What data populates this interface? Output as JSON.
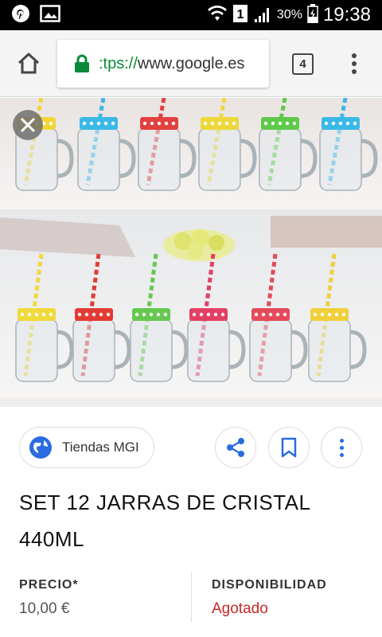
{
  "status_bar": {
    "sim_badge": "1",
    "battery": "30%",
    "time": "19:38"
  },
  "browser": {
    "url_scheme": ":tps://",
    "url_host": "www.google.es",
    "tab_count": "4"
  },
  "image": {
    "jars_top_lids": [
      "#f2d63a",
      "#3bb9e6",
      "#e2403f",
      "#ecd83a",
      "#5fc94a",
      "#3bb9e6"
    ],
    "jars_bottom_lids": [
      "#f0d93a",
      "#e23b34",
      "#66c84f",
      "#e33f63",
      "#e44a5a",
      "#f0cf3a"
    ]
  },
  "product": {
    "source": "Tiendas MGI",
    "title": "SET 12 JARRAS DE CRISTAL 440ML",
    "price_label": "PRECIO*",
    "price_value": "10,00 €",
    "availability_label": "DISPONIBILIDAD",
    "availability_value": "Agotado"
  },
  "colors": {
    "accent": "#2a6be0",
    "sold_out": "#c62828",
    "secure": "#0a8a3a"
  }
}
